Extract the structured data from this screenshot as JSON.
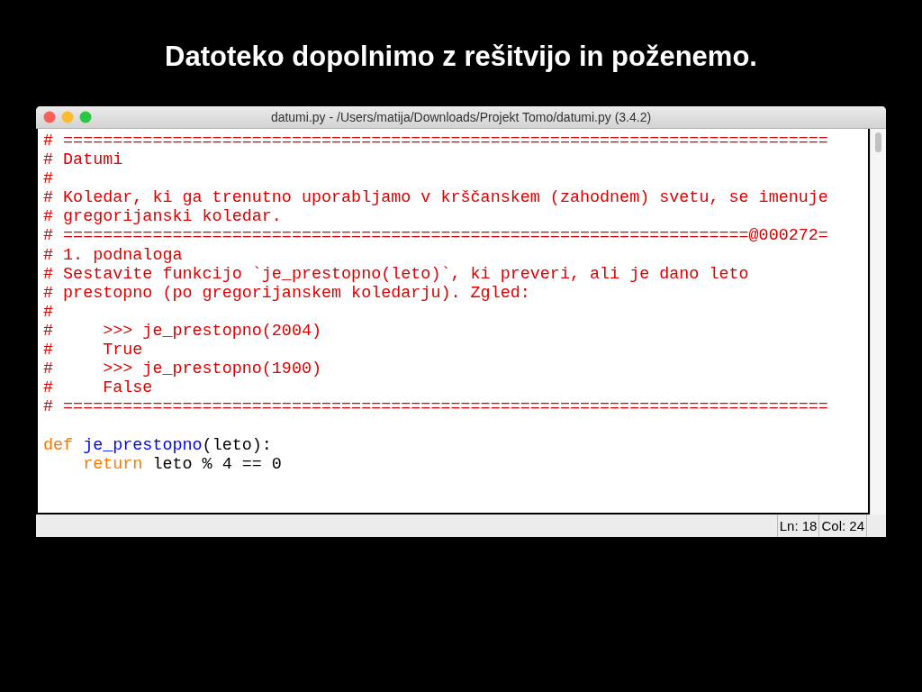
{
  "slide_title": "Datoteko dopolnimo z rešitvijo in poženemo.",
  "window": {
    "title": "datumi.py - /Users/matija/Downloads/Projekt Tomo/datumi.py (3.4.2)"
  },
  "editor": {
    "lines": [
      {
        "kind": "code",
        "segments": [
          {
            "kind": "comment",
            "text": "# ============================================================================="
          }
        ]
      },
      {
        "kind": "code",
        "segments": [
          {
            "kind": "comment",
            "text": "# Datumi"
          }
        ]
      },
      {
        "kind": "code",
        "segments": [
          {
            "kind": "comment",
            "text": "#"
          }
        ]
      },
      {
        "kind": "code",
        "segments": [
          {
            "kind": "comment",
            "text": "# Koledar, ki ga trenutno uporabljamo v krščanskem (zahodnem) svetu, se imenuje"
          }
        ]
      },
      {
        "kind": "code",
        "segments": [
          {
            "kind": "comment",
            "text": "# gregorijanski koledar."
          }
        ]
      },
      {
        "kind": "code",
        "segments": [
          {
            "kind": "comment",
            "text": "# =====================================================================@000272="
          }
        ]
      },
      {
        "kind": "code",
        "segments": [
          {
            "kind": "comment",
            "text": "# 1. podnaloga"
          }
        ]
      },
      {
        "kind": "code",
        "segments": [
          {
            "kind": "comment",
            "text": "# Sestavite funkcijo `je_prestopno(leto)`, ki preveri, ali je dano leto"
          }
        ]
      },
      {
        "kind": "code",
        "segments": [
          {
            "kind": "comment",
            "text": "# prestopno (po gregorijanskem koledarju). Zgled:"
          }
        ]
      },
      {
        "kind": "code",
        "segments": [
          {
            "kind": "comment",
            "text": "#"
          }
        ]
      },
      {
        "kind": "code",
        "segments": [
          {
            "kind": "comment",
            "text": "#     >>> je_prestopno(2004)"
          }
        ]
      },
      {
        "kind": "code",
        "segments": [
          {
            "kind": "comment",
            "text": "#     True"
          }
        ]
      },
      {
        "kind": "code",
        "segments": [
          {
            "kind": "comment",
            "text": "#     >>> je_prestopno(1900)"
          }
        ]
      },
      {
        "kind": "code",
        "segments": [
          {
            "kind": "comment",
            "text": "#     False"
          }
        ]
      },
      {
        "kind": "code",
        "segments": [
          {
            "kind": "comment",
            "text": "# ============================================================================="
          }
        ]
      },
      {
        "kind": "blank"
      },
      {
        "kind": "code",
        "segments": [
          {
            "kind": "keyword",
            "text": "def "
          },
          {
            "kind": "defname",
            "text": "je_prestopno"
          },
          {
            "kind": "plain",
            "text": "(leto):"
          }
        ]
      },
      {
        "kind": "code",
        "segments": [
          {
            "kind": "keyword",
            "text": "    return"
          },
          {
            "kind": "plain",
            "text": " leto % 4 == 0"
          }
        ]
      }
    ]
  },
  "status_bar": {
    "line": "Ln: 18",
    "column": "Col: 24"
  }
}
